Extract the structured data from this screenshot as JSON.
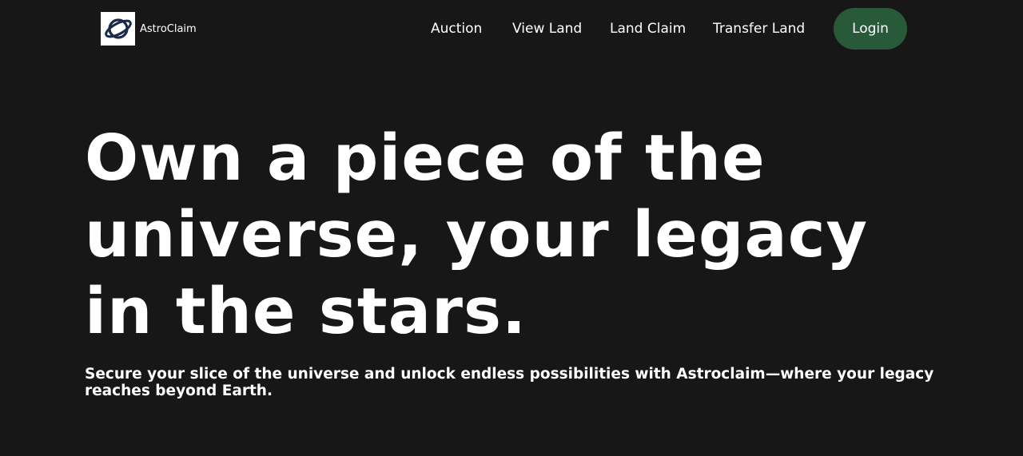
{
  "colors": {
    "background": "#171717",
    "text": "#ffffff",
    "login_button": "#285a3a",
    "logo_background": "#ffffff",
    "logo_stroke": "#1b2a4a"
  },
  "brand": {
    "name": "AstroClaim",
    "logo_icon": "planet-ring-icon"
  },
  "nav": {
    "items": [
      {
        "label": "Auction"
      },
      {
        "label": "View Land"
      },
      {
        "label": "Land Claim"
      },
      {
        "label": "Transfer Land"
      }
    ],
    "login_label": "Login"
  },
  "hero": {
    "title": "Own a piece of the universe, your legacy in the stars.",
    "subtitle": "Secure your slice of the universe and unlock endless possibilities with Astroclaim—where your legacy reaches beyond Earth."
  }
}
